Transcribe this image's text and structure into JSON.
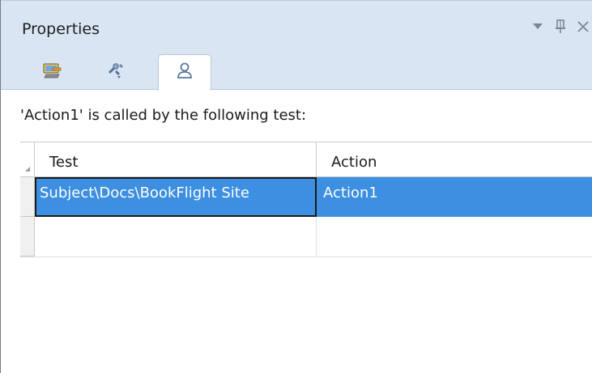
{
  "panel": {
    "title": "Properties",
    "controls": [
      {
        "name": "dropdown-icon",
        "glyph": "▾"
      },
      {
        "name": "pin-icon",
        "glyph": "⌖"
      },
      {
        "name": "close-icon",
        "glyph": "✕"
      }
    ]
  },
  "tabs": [
    {
      "name": "tab-general",
      "icon": "properties-monitor-icon",
      "active": false
    },
    {
      "name": "tab-parameters",
      "icon": "parameters-icon",
      "active": false
    },
    {
      "name": "tab-used-by",
      "icon": "user-icon",
      "active": true
    }
  ],
  "caption": "'Action1' is called by the following test:",
  "grid": {
    "columns": [
      "Test",
      "Action"
    ],
    "rows": [
      {
        "test": "Subject\\Docs\\BookFlight Site",
        "action": "Action1",
        "selected": true
      },
      {
        "test": "",
        "action": "",
        "selected": false
      }
    ]
  },
  "colors": {
    "title_bar_bg": "#d9e5f3",
    "selection": "#3c8fe1",
    "selection_text": "#ffffff"
  }
}
